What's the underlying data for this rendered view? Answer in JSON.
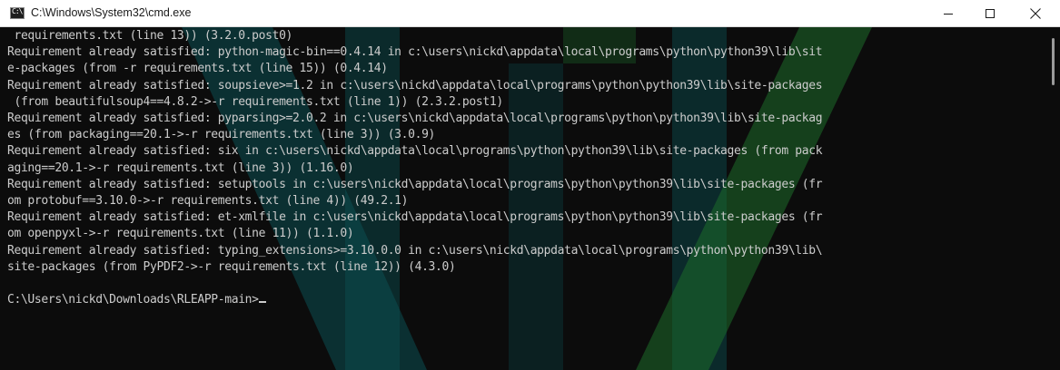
{
  "window": {
    "title": "C:\\Windows\\System32\\cmd.exe",
    "icon": "cmd-icon",
    "icon_glyph": "C:\\",
    "controls": [
      "minimize-icon",
      "maximize-icon",
      "close-icon"
    ]
  },
  "console": {
    "lines": [
      " requirements.txt (line 13)) (3.2.0.post0)",
      "Requirement already satisfied: python-magic-bin==0.4.14 in c:\\users\\nickd\\appdata\\local\\programs\\python\\python39\\lib\\sit",
      "e-packages (from -r requirements.txt (line 15)) (0.4.14)",
      "Requirement already satisfied: soupsieve>=1.2 in c:\\users\\nickd\\appdata\\local\\programs\\python\\python39\\lib\\site-packages",
      " (from beautifulsoup4==4.8.2->-r requirements.txt (line 1)) (2.3.2.post1)",
      "Requirement already satisfied: pyparsing>=2.0.2 in c:\\users\\nickd\\appdata\\local\\programs\\python\\python39\\lib\\site-packag",
      "es (from packaging==20.1->-r requirements.txt (line 3)) (3.0.9)",
      "Requirement already satisfied: six in c:\\users\\nickd\\appdata\\local\\programs\\python\\python39\\lib\\site-packages (from pack",
      "aging==20.1->-r requirements.txt (line 3)) (1.16.0)",
      "Requirement already satisfied: setuptools in c:\\users\\nickd\\appdata\\local\\programs\\python\\python39\\lib\\site-packages (fr",
      "om protobuf==3.10.0->-r requirements.txt (line 4)) (49.2.1)",
      "Requirement already satisfied: et-xmlfile in c:\\users\\nickd\\appdata\\local\\programs\\python\\python39\\lib\\site-packages (fr",
      "om openpyxl->-r requirements.txt (line 11)) (1.1.0)",
      "Requirement already satisfied: typing_extensions>=3.10.0.0 in c:\\users\\nickd\\appdata\\local\\programs\\python\\python39\\lib\\",
      "site-packages (from PyPDF2->-r requirements.txt (line 12)) (4.3.0)",
      "",
      "C:\\Users\\nickd\\Downloads\\RLEAPP-main>"
    ],
    "text_color": "#cccccc",
    "background_color": "#0c0c0c",
    "deco_teal": "#0b4f52",
    "deco_green": "#1d6b2a"
  }
}
